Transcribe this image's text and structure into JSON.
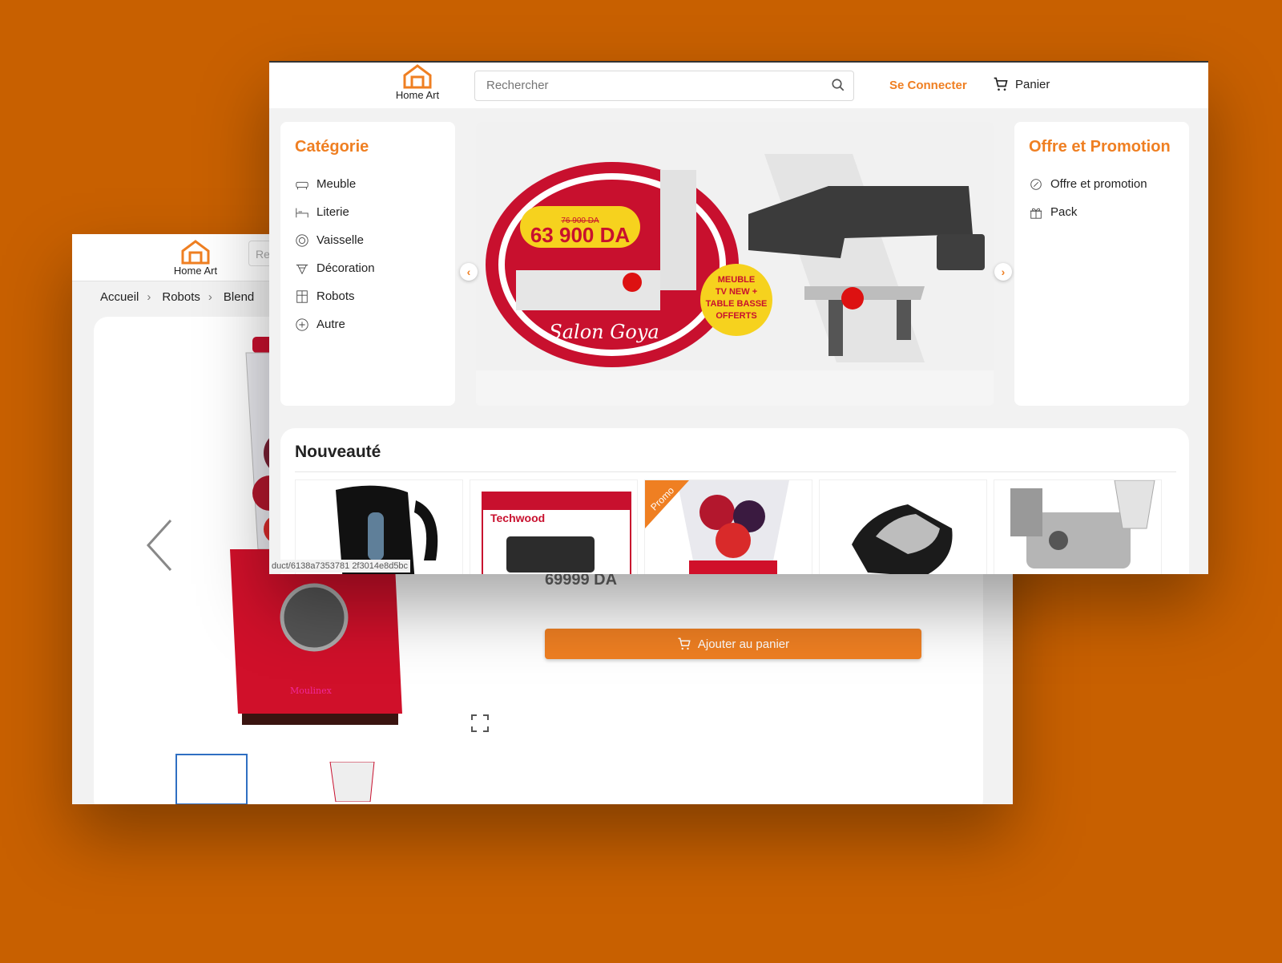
{
  "brand": {
    "name": "Home Art",
    "accent": "#ef7f22",
    "background": "#c86000"
  },
  "back_window": {
    "breadcrumb": [
      "Accueil",
      "Robots",
      "Blend"
    ],
    "price_partial": "69999 DA",
    "add_to_cart": "Ajouter au panier",
    "search_partial": "Re",
    "product_image": "red-blender"
  },
  "front_window": {
    "search_placeholder": "Rechercher",
    "login": "Se Connecter",
    "cart": "Panier",
    "categories": {
      "title": "Catégorie",
      "items": [
        {
          "label": "Meuble",
          "icon": "sofa-icon"
        },
        {
          "label": "Literie",
          "icon": "bed-icon"
        },
        {
          "label": "Vaisselle",
          "icon": "plate-icon"
        },
        {
          "label": "Décoration",
          "icon": "decoration-icon"
        },
        {
          "label": "Robots",
          "icon": "appliance-icon"
        },
        {
          "label": "Autre",
          "icon": "plus-circle-icon"
        }
      ]
    },
    "offers": {
      "title": "Offre et Promotion",
      "items": [
        {
          "label": "Offre et promotion",
          "icon": "discount-icon"
        },
        {
          "label": "Pack",
          "icon": "gift-icon"
        }
      ]
    },
    "banner": {
      "old_price": "76 900 DA",
      "price": "63 900 DA",
      "offer_lines": [
        "MEUBLE",
        "TV NEW +",
        "TABLE BASSE",
        "OFFERTS"
      ],
      "name": "Salon Goya"
    },
    "new_section": {
      "title": "Nouveauté",
      "products": [
        {
          "image": "kettle"
        },
        {
          "image": "techwood-grill",
          "brand": "Techwood"
        },
        {
          "image": "blender",
          "badge": "Promo"
        },
        {
          "image": "sandwich-maker"
        },
        {
          "image": "meat-grinder"
        }
      ]
    },
    "status_url": "duct/6138a7353781 2f3014e8d5bc"
  }
}
